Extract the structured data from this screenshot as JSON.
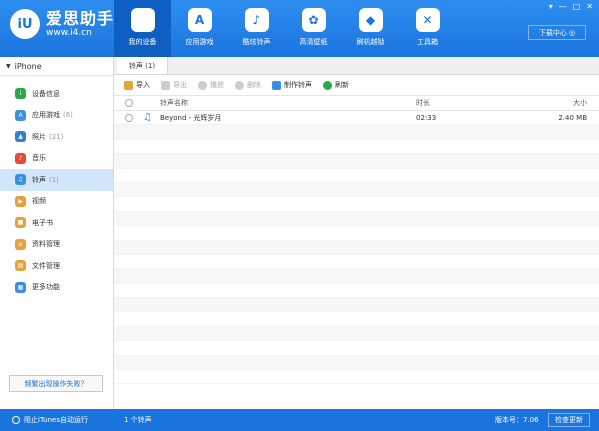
{
  "app": {
    "logo_mark": "iU",
    "name": "爱思助手",
    "url": "www.i4.cn"
  },
  "nav": [
    {
      "label": "我的设备",
      "icon": "apple-icon",
      "glyph": "",
      "active": true
    },
    {
      "label": "应用游戏",
      "icon": "app-store-icon",
      "glyph": "A"
    },
    {
      "label": "酷炫铃声",
      "icon": "bell-icon",
      "glyph": "♪"
    },
    {
      "label": "高清壁纸",
      "icon": "flower-icon",
      "glyph": "✿"
    },
    {
      "label": "刷机越狱",
      "icon": "dropbox-icon",
      "glyph": "◆"
    },
    {
      "label": "工具箱",
      "icon": "tools-icon",
      "glyph": "✕"
    }
  ],
  "window_controls": [
    "▾",
    "—",
    "□",
    "✕"
  ],
  "download_center": "下载中心 ◎",
  "device": {
    "name": "iPhone"
  },
  "sidebar": {
    "items": [
      {
        "label": "设备信息",
        "count": "",
        "icon": "info-icon",
        "glyph": "i",
        "color": "#2aa84a"
      },
      {
        "label": "应用游戏",
        "count": "(6)",
        "icon": "apps-icon",
        "glyph": "A",
        "color": "#3a8ee6"
      },
      {
        "label": "照片",
        "count": "(21)",
        "icon": "photo-icon",
        "glyph": "▲",
        "color": "#2f7fd8"
      },
      {
        "label": "音乐",
        "count": "",
        "icon": "music-icon",
        "glyph": "♪",
        "color": "#e64a3a"
      },
      {
        "label": "铃声",
        "count": "(1)",
        "icon": "bell-icon",
        "glyph": "♫",
        "color": "#3a8ee6",
        "active": true
      },
      {
        "label": "视频",
        "count": "",
        "icon": "video-icon",
        "glyph": "▶",
        "color": "#e6a23a"
      },
      {
        "label": "电子书",
        "count": "",
        "icon": "ebook-icon",
        "glyph": "■",
        "color": "#e6a23a"
      },
      {
        "label": "资料管理",
        "count": "",
        "icon": "contacts-icon",
        "glyph": "≡",
        "color": "#e6a23a"
      },
      {
        "label": "文件管理",
        "count": "",
        "icon": "files-icon",
        "glyph": "▤",
        "color": "#e6a23a"
      },
      {
        "label": "更多功能",
        "count": "",
        "icon": "more-icon",
        "glyph": "▦",
        "color": "#3a8ee6"
      }
    ],
    "help_button": "频繁出现操作失败？"
  },
  "tab": {
    "label": "铃声 (1)"
  },
  "toolbar": [
    {
      "label": "导入",
      "icon": "import-icon",
      "color": "#e6a23a",
      "enabled": true
    },
    {
      "label": "导出",
      "icon": "export-icon",
      "color": "#cccccc",
      "enabled": false
    },
    {
      "label": "播放",
      "icon": "play-icon",
      "color": "#cccccc",
      "enabled": false
    },
    {
      "label": "删除",
      "icon": "delete-icon",
      "color": "#cccccc",
      "enabled": false
    },
    {
      "label": "制作铃声",
      "icon": "make-ringtone-icon",
      "color": "#3a8ee6",
      "enabled": true
    },
    {
      "label": "刷新",
      "icon": "refresh-icon",
      "color": "#2aa84a",
      "enabled": true
    }
  ],
  "table": {
    "columns": {
      "name": "铃声名称",
      "duration": "时长",
      "size": "大小"
    },
    "rows": [
      {
        "name": "Beyond - 光辉岁月",
        "duration": "02:33",
        "size": "2.40 MB"
      }
    ]
  },
  "status": {
    "itunes_block": "阻止iTunes自动运行",
    "count": "1 个铃声",
    "version": "版本号：7.06",
    "update": "检查更新"
  }
}
